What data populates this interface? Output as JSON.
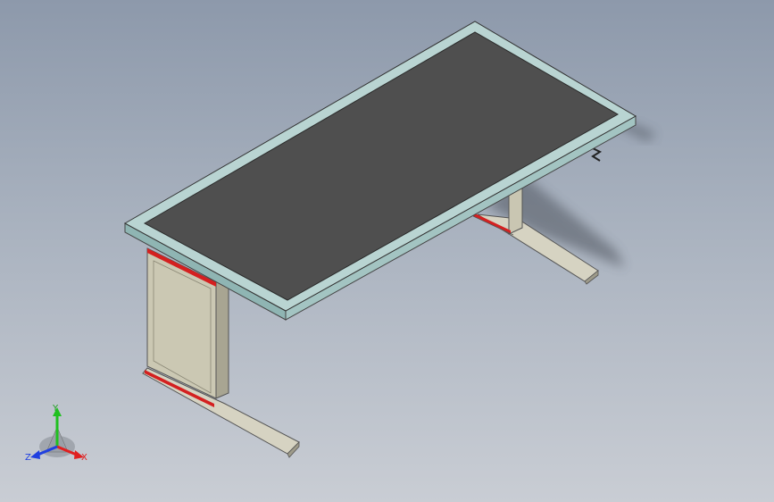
{
  "viewport": {
    "background_top": "#8d99ab",
    "background_bottom": "#c9cdd4"
  },
  "model": {
    "part": "desk",
    "tabletop_color": "#4f4f4f",
    "edge_band_color": "#b9d4d2",
    "leg_panel_color": "#c9c6b2",
    "accent_color": "#d42020"
  },
  "triad": {
    "x_label": "X",
    "y_label": "Y",
    "z_label": "Z",
    "x_color": "#e02020",
    "y_color": "#20c020",
    "z_color": "#2040e0"
  }
}
